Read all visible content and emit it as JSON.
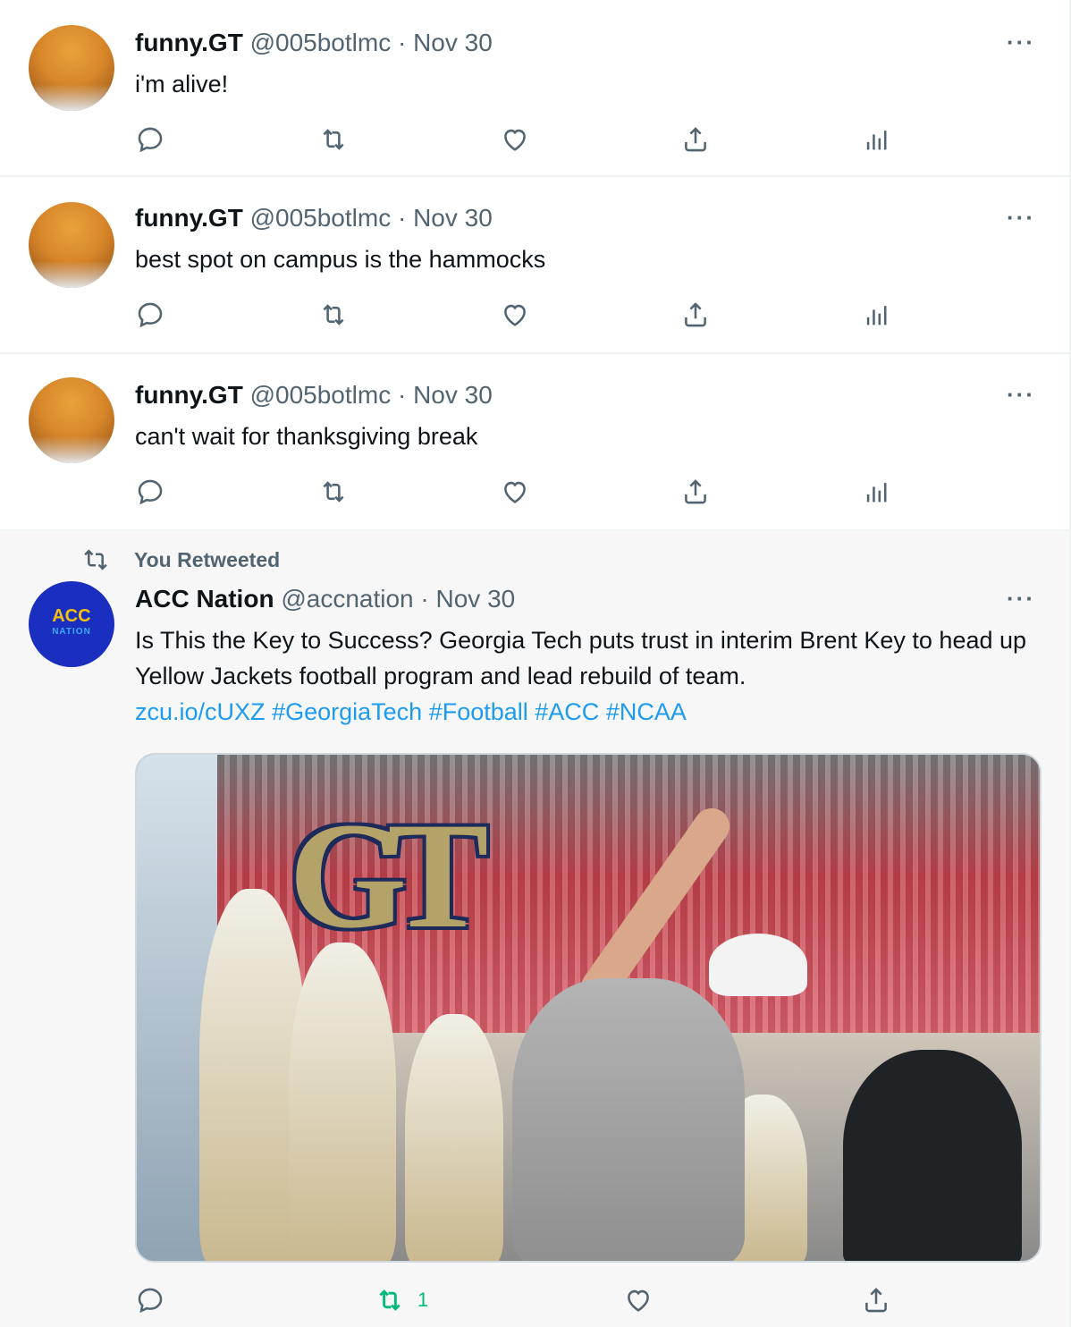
{
  "tweets": [
    {
      "name": "funny.GT",
      "handle": "@005botlmc",
      "sep": "·",
      "date": "Nov 30",
      "text": "i'm alive!",
      "more": "···"
    },
    {
      "name": "funny.GT",
      "handle": "@005botlmc",
      "sep": "·",
      "date": "Nov 30",
      "text": "best spot on campus is the hammocks",
      "more": "···"
    },
    {
      "name": "funny.GT",
      "handle": "@005botlmc",
      "sep": "·",
      "date": "Nov 30",
      "text": "can't wait for thanksgiving break",
      "more": "···"
    }
  ],
  "retweet": {
    "label": "You Retweeted",
    "name": "ACC Nation",
    "handle": "@accnation",
    "sep": "·",
    "date": "Nov 30",
    "more": "···",
    "text": "Is This the Key to Success? Georgia Tech puts trust in interim Brent Key to head up Yellow Jackets football program and lead rebuild of team.",
    "links": [
      "zcu.io/cUXZ",
      "#GeorgiaTech",
      "#Football",
      "#ACC",
      "#NCAA"
    ],
    "retweet_count": "1",
    "avatar_text": "ACC",
    "avatar_subtext": "NATION",
    "image_logo": "GT"
  },
  "icons": [
    "reply-icon",
    "retweet-icon",
    "like-icon",
    "share-icon",
    "analytics-icon",
    "more-icon"
  ],
  "colors": {
    "accent": "#1d9bf0",
    "retweet_active": "#00ba7c",
    "muted": "#536471"
  }
}
